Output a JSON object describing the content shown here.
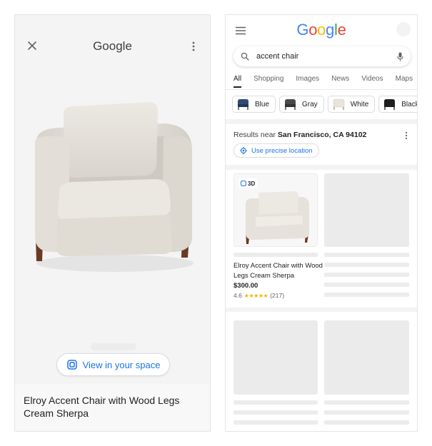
{
  "viewer": {
    "title": "Google",
    "view_in_space_label": "View in your space",
    "caption": "Elroy Accent Chair with Wood Legs Cream Sherpa"
  },
  "search": {
    "logo_letters": [
      "G",
      "o",
      "o",
      "g",
      "l",
      "e"
    ],
    "logo_colors": [
      "#4285F4",
      "#EA4335",
      "#FBBC05",
      "#4285F4",
      "#34A853",
      "#EA4335"
    ],
    "query": "accent chair",
    "tabs": [
      "All",
      "Shopping",
      "Images",
      "News",
      "Videos",
      "Maps"
    ],
    "active_tab": "All",
    "chips": [
      {
        "label": "Blue",
        "color": "#2f4a72"
      },
      {
        "label": "Gray",
        "color": "#4a4a4a"
      },
      {
        "label": "White",
        "color": "#e9e4dc"
      },
      {
        "label": "Black",
        "color": "#1e1e1e"
      }
    ],
    "results_near_prefix": "Results near",
    "results_near_location": "San Francisco, CA 94102",
    "precise_location_label": "Use precise location",
    "product": {
      "badge": "3D",
      "title": "Elroy Accent Chair with Wood Legs Cream Sherpa",
      "price": "$300.00",
      "rating_value": "4.6",
      "stars": "★★★★★",
      "review_count": "(217)"
    }
  },
  "colors": {
    "accent_blue": "#1a73e8",
    "chair_fabric": "#e6e2db",
    "chair_wood": "#6b3a24"
  }
}
